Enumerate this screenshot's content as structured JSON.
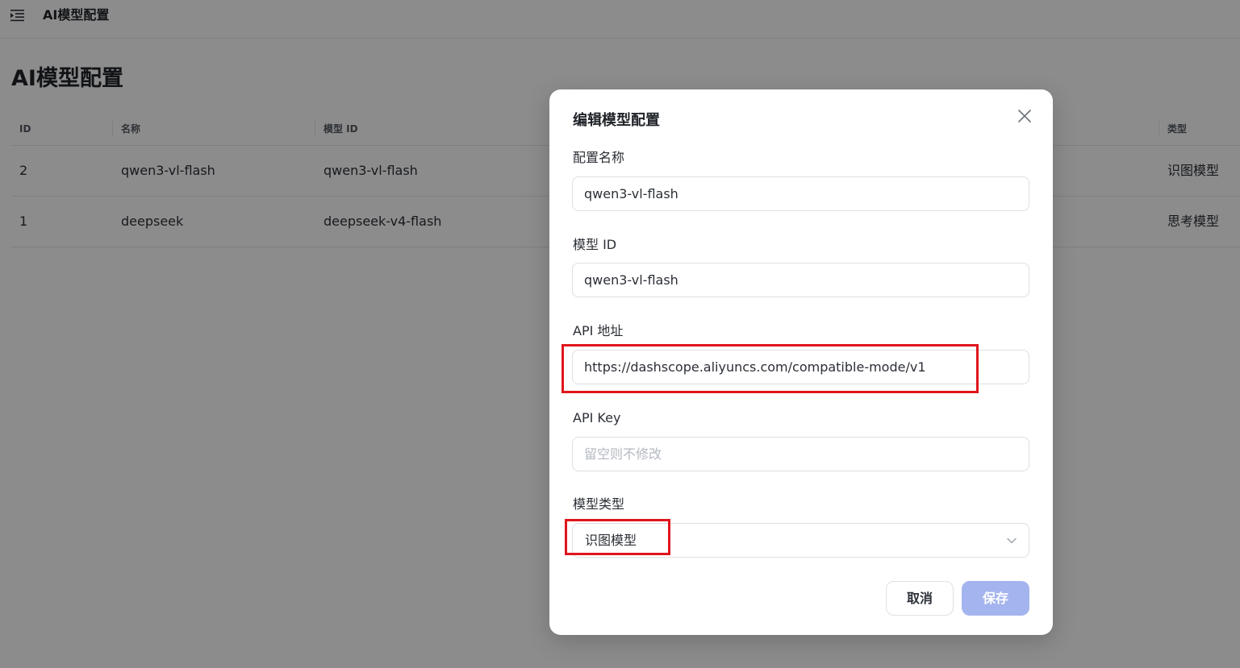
{
  "topbar": {
    "icon": "menu-fold-icon",
    "title": "AI模型配置"
  },
  "page": {
    "title": "AI模型配置"
  },
  "table": {
    "columns": [
      "ID",
      "名称",
      "模型 ID",
      "类型"
    ],
    "rows": [
      {
        "id": "2",
        "name": "qwen3-vl-flash",
        "model_id": "qwen3-vl-flash",
        "type": "识图模型"
      },
      {
        "id": "1",
        "name": "deepseek",
        "model_id": "deepseek-v4-flash",
        "type": "思考模型"
      }
    ]
  },
  "modal": {
    "title": "编辑模型配置",
    "close_icon": "close-icon",
    "fields": {
      "config_name": {
        "label": "配置名称",
        "value": "qwen3-vl-flash"
      },
      "model_id": {
        "label": "模型 ID",
        "value": "qwen3-vl-flash"
      },
      "api_url": {
        "label": "API 地址",
        "value": "https://dashscope.aliyuncs.com/compatible-mode/v1"
      },
      "api_key": {
        "label": "API Key",
        "placeholder": "留空则不修改",
        "value": ""
      },
      "model_type": {
        "label": "模型类型",
        "value": "识图模型"
      }
    },
    "buttons": {
      "cancel": "取消",
      "save": "保存"
    }
  },
  "colors": {
    "overlay": "#000000",
    "primary_disabled": "#a4b4ee",
    "highlight": "#e0151c",
    "border": "#dcdfe4"
  }
}
